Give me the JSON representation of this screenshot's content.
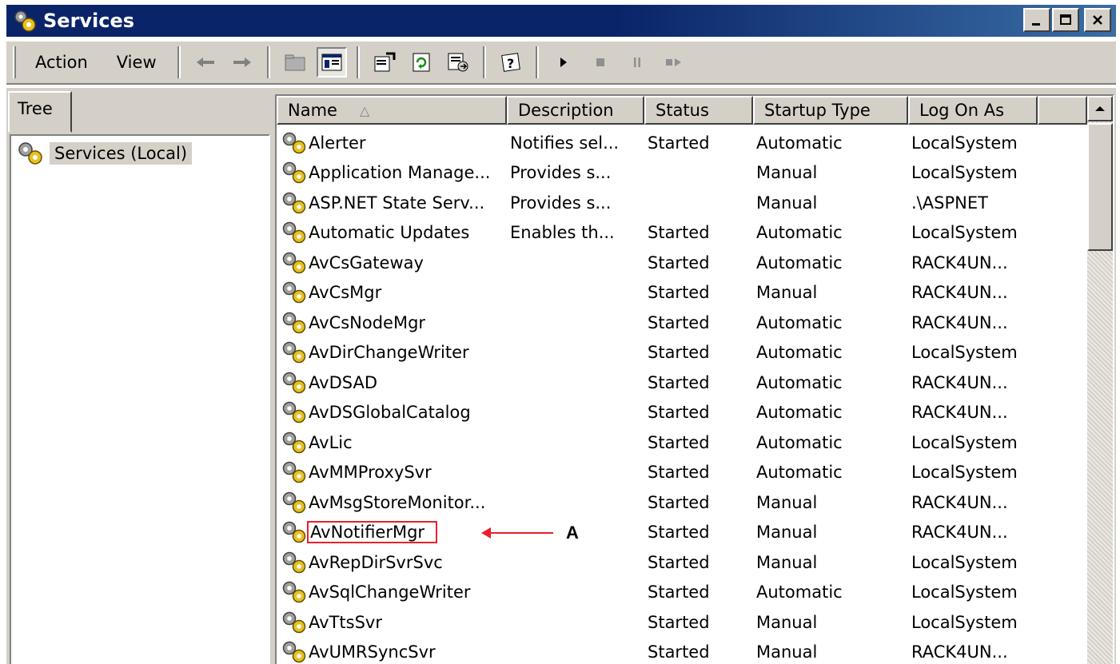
{
  "window": {
    "title": "Services",
    "controls": {
      "minimize": "_",
      "maximize": "□",
      "close": "×"
    }
  },
  "toolbar": {
    "menu": [
      {
        "label": "Action"
      },
      {
        "label": "View"
      }
    ],
    "icons": [
      "back-arrow-icon",
      "forward-arrow-icon",
      "up-folder-icon",
      "show-hide-tree-icon",
      "properties-icon",
      "refresh-icon",
      "export-list-icon",
      "help-icon",
      "start-service-icon",
      "stop-service-icon",
      "pause-service-icon",
      "restart-service-icon"
    ]
  },
  "tree": {
    "tab_label": "Tree",
    "root_label": "Services (Local)"
  },
  "list": {
    "columns": [
      "Name",
      "Description",
      "Status",
      "Startup Type",
      "Log On As"
    ],
    "sorted_column": "Name",
    "rows": [
      {
        "name": "Alerter",
        "description": "Notifies sel...",
        "status": "Started",
        "startup": "Automatic",
        "logon": "LocalSystem"
      },
      {
        "name": "Application Manage...",
        "description": "Provides s...",
        "status": "",
        "startup": "Manual",
        "logon": "LocalSystem"
      },
      {
        "name": "ASP.NET State Serv...",
        "description": "Provides s...",
        "status": "",
        "startup": "Manual",
        "logon": ".\\ASPNET"
      },
      {
        "name": "Automatic Updates",
        "description": "Enables th...",
        "status": "Started",
        "startup": "Automatic",
        "logon": "LocalSystem"
      },
      {
        "name": "AvCsGateway",
        "description": "",
        "status": "Started",
        "startup": "Automatic",
        "logon": "RACK4UN..."
      },
      {
        "name": "AvCsMgr",
        "description": "",
        "status": "Started",
        "startup": "Manual",
        "logon": "RACK4UN..."
      },
      {
        "name": "AvCsNodeMgr",
        "description": "",
        "status": "Started",
        "startup": "Automatic",
        "logon": "RACK4UN..."
      },
      {
        "name": "AvDirChangeWriter",
        "description": "",
        "status": "Started",
        "startup": "Automatic",
        "logon": "LocalSystem"
      },
      {
        "name": "AvDSAD",
        "description": "",
        "status": "Started",
        "startup": "Automatic",
        "logon": "RACK4UN..."
      },
      {
        "name": "AvDSGlobalCatalog",
        "description": "",
        "status": "Started",
        "startup": "Automatic",
        "logon": "RACK4UN..."
      },
      {
        "name": "AvLic",
        "description": "",
        "status": "Started",
        "startup": "Automatic",
        "logon": "LocalSystem"
      },
      {
        "name": "AvMMProxySvr",
        "description": "",
        "status": "Started",
        "startup": "Automatic",
        "logon": "LocalSystem"
      },
      {
        "name": "AvMsgStoreMonitor...",
        "description": "",
        "status": "Started",
        "startup": "Manual",
        "logon": "RACK4UN..."
      },
      {
        "name": "AvNotifierMgr",
        "description": "",
        "status": "Started",
        "startup": "Manual",
        "logon": "RACK4UN..."
      },
      {
        "name": "AvRepDirSvrSvc",
        "description": "",
        "status": "Started",
        "startup": "Manual",
        "logon": "LocalSystem"
      },
      {
        "name": "AvSqlChangeWriter",
        "description": "",
        "status": "Started",
        "startup": "Automatic",
        "logon": "LocalSystem"
      },
      {
        "name": "AvTtsSvr",
        "description": "",
        "status": "Started",
        "startup": "Manual",
        "logon": "LocalSystem"
      },
      {
        "name": "AvUMRSyncSvr",
        "description": "",
        "status": "Started",
        "startup": "Manual",
        "logon": "RACK4UN..."
      }
    ]
  },
  "annotation": {
    "highlighted_row": "AvNotifierMgr",
    "label": "A",
    "color": "#e8202a"
  },
  "colors": {
    "titlebar": "#0a246a",
    "chrome": "#d4d0c8",
    "list_background": "#ffffff"
  }
}
